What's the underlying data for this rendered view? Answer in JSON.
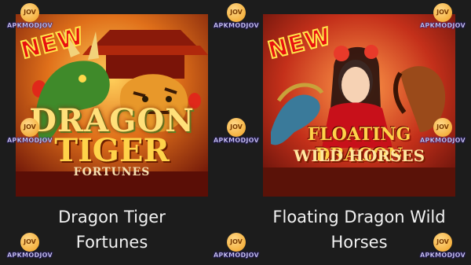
{
  "games": [
    {
      "badge": "NEW",
      "logo_line1": "DRAGON",
      "logo_line2": "TIGER",
      "logo_line3": "FORTUNES",
      "title_line1": "Dragon Tiger",
      "title_line2": "Fortunes"
    },
    {
      "badge": "NEW",
      "logo_line1": "FLOATING DRAGON",
      "logo_line2": "WILD HORSES",
      "title_line1": "Floating Dragon Wild",
      "title_line2": "Horses"
    }
  ],
  "watermark": {
    "circle": "JOV",
    "text": "APKMODJOV"
  },
  "colors": {
    "background": "#1c1c1c",
    "badge": "#e81010",
    "watermark_circle": "#f0a020"
  }
}
